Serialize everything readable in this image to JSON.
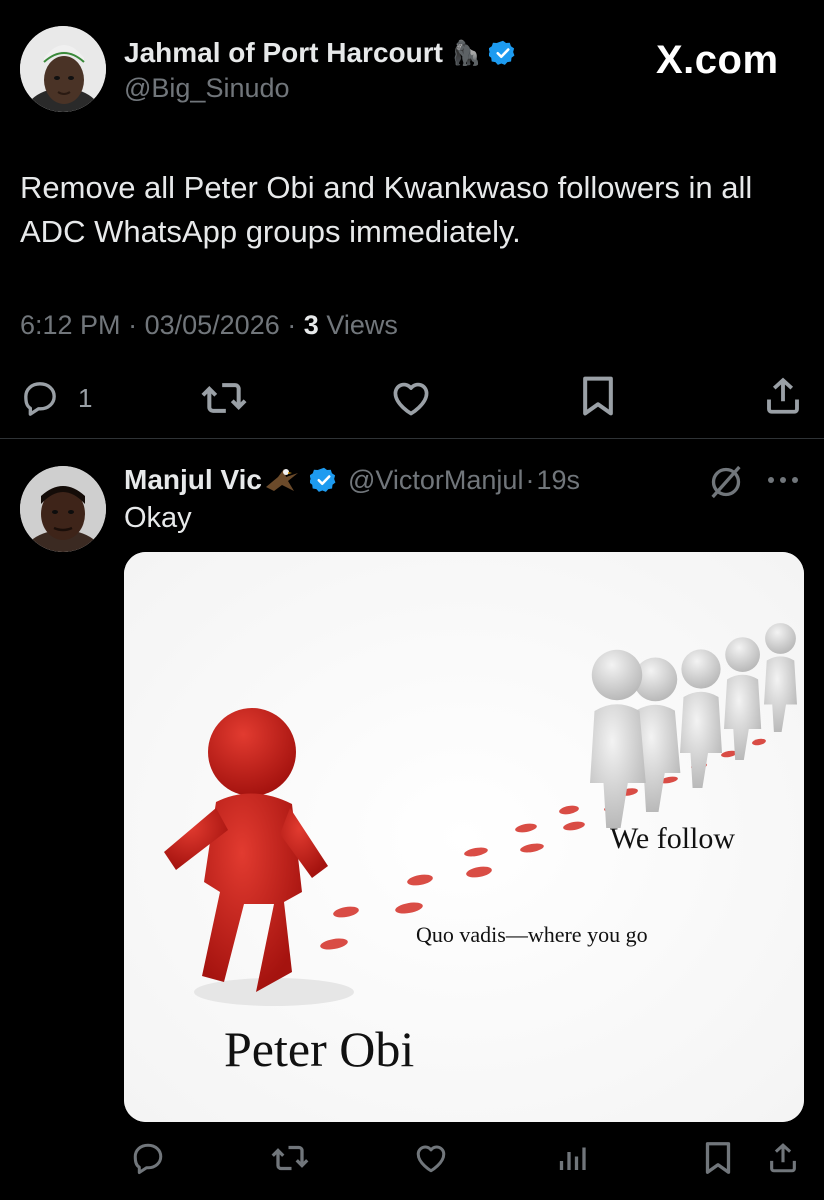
{
  "branding": {
    "site": "X.com"
  },
  "post": {
    "author_name": "Jahmal of Port Harcourt",
    "author_emoji": "🦍",
    "handle": "@Big_Sinudo",
    "text": "Remove all Peter Obi and Kwankwaso followers in all ADC WhatsApp groups immediately.",
    "time": "6:12 PM",
    "date": "03/05/2026",
    "separator": "·",
    "views_count": "3",
    "views_label": "Views",
    "reply_count": "1",
    "verified_color": "#1d9bf0"
  },
  "reply": {
    "author_name": "Manjul Vic",
    "handle": "@VictorManjul",
    "time": "19s",
    "text": "Okay",
    "media": {
      "caption_top": "We follow",
      "caption_mid": "Quo vadis—where you go",
      "caption_main": "Peter Obi"
    }
  },
  "icons": {
    "reply": "reply-icon",
    "repost": "repost-icon",
    "like": "heart-icon",
    "bookmark": "bookmark-icon",
    "share": "share-icon",
    "analytics": "analytics-icon",
    "grok": "grok-icon",
    "more": "more-icon"
  }
}
